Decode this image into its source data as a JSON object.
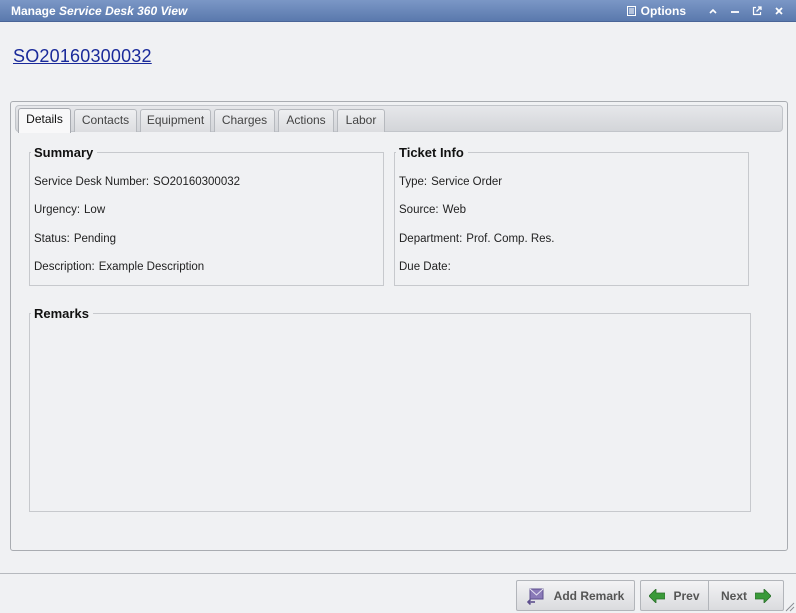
{
  "window": {
    "title_prefix": "Manage",
    "title_emph": "Service Desk 360 View",
    "options_label": "Options"
  },
  "record": {
    "number_link": "SO20160300032"
  },
  "tabs": [
    {
      "label": "Details",
      "active": true
    },
    {
      "label": "Contacts"
    },
    {
      "label": "Equipment"
    },
    {
      "label": "Charges"
    },
    {
      "label": "Actions"
    },
    {
      "label": "Labor"
    }
  ],
  "summary": {
    "legend": "Summary",
    "fields": [
      {
        "label": "Service Desk Number:",
        "value": "SO20160300032"
      },
      {
        "label": "Urgency:",
        "value": "Low"
      },
      {
        "label": "Status:",
        "value": "Pending"
      },
      {
        "label": "Description:",
        "value": "Example Description"
      }
    ]
  },
  "ticket_info": {
    "legend": "Ticket Info",
    "fields": [
      {
        "label": "Type:",
        "value": "Service Order"
      },
      {
        "label": "Source:",
        "value": "Web"
      },
      {
        "label": "Department:",
        "value": "Prof. Comp. Res."
      },
      {
        "label": "Due Date:",
        "value": ""
      }
    ]
  },
  "remarks": {
    "legend": "Remarks"
  },
  "footer": {
    "add_remark_label": "Add Remark",
    "prev_label": "Prev",
    "next_label": "Next"
  },
  "colors": {
    "titlebar": "#5a79ad",
    "link": "#1a2a9a",
    "arrow_green": "#3a9a3a"
  },
  "icons": [
    "list-icon",
    "minimize-up-icon",
    "minimize-icon",
    "popout-icon",
    "close-icon",
    "remark-icon",
    "arrow-left-icon",
    "arrow-right-icon"
  ]
}
